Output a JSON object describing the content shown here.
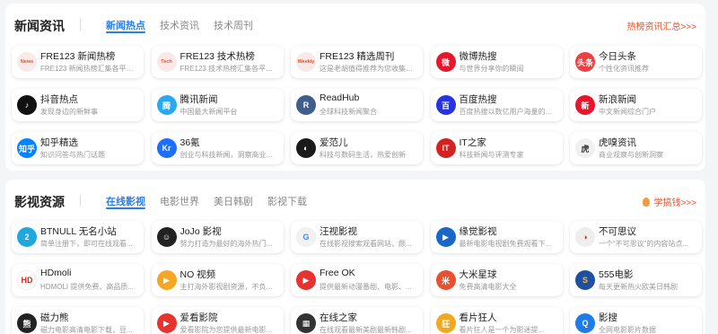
{
  "news": {
    "title": "新闻资讯",
    "tabs": [
      {
        "label": "新闻热点",
        "active": true
      },
      {
        "label": "技术资讯",
        "active": false
      },
      {
        "label": "技术周刊",
        "active": false
      }
    ],
    "more_link": "热榜资讯汇总>>>",
    "cards": [
      {
        "name": "FRE123 新闻热榜",
        "desc": "FRE123 新闻热榜汇集各平台热点新闻",
        "icon": "news-icon",
        "icon_text": "News",
        "color": "#fde8e8",
        "text_color": "#e5532b"
      },
      {
        "name": "FRE123 技术热榜",
        "desc": "FRE123 技术热榜汇集各平台技术文章",
        "icon": "tech-icon",
        "icon_text": "Tech",
        "color": "#fde8e8",
        "text_color": "#e5532b"
      },
      {
        "name": "FRE123 精选周刊",
        "desc": "这是老胡值得推荐为您收集的信息",
        "icon": "weekly-icon",
        "icon_text": "Weekly",
        "color": "#fde8e8",
        "text_color": "#e5532b"
      },
      {
        "name": "微博热搜",
        "desc": "与世界分享你的瞬间",
        "icon": "weibo-icon",
        "icon_text": "微",
        "color": "#e6162d",
        "text_color": "#ffffff"
      },
      {
        "name": "今日头条",
        "desc": "个性化资讯推荐",
        "icon": "toutiao-icon",
        "icon_text": "头条",
        "color": "#ed4040",
        "text_color": "#ffffff"
      },
      {
        "name": "抖音热点",
        "desc": "发现身边的新鲜事",
        "icon": "douyin-icon",
        "icon_text": "♪",
        "color": "#111111",
        "text_color": "#ffffff"
      },
      {
        "name": "腾讯新闻",
        "desc": "中国最大新闻平台",
        "icon": "tencent-news-icon",
        "icon_text": "腾",
        "color": "#2aa8f2",
        "text_color": "#ffffff"
      },
      {
        "name": "ReadHub",
        "desc": "全球科技新闻聚合",
        "icon": "readhub-icon",
        "icon_text": "R",
        "color": "#3f5e8c",
        "text_color": "#ffffff"
      },
      {
        "name": "百度热搜",
        "desc": "百度热搜以数亿用户海量的真实数据...",
        "icon": "baidu-icon",
        "icon_text": "百",
        "color": "#2932e1",
        "text_color": "#ffffff"
      },
      {
        "name": "新浪新闻",
        "desc": "中文新闻综合门户",
        "icon": "sina-icon",
        "icon_text": "新",
        "color": "#e6162d",
        "text_color": "#ffffff"
      },
      {
        "name": "知乎精选",
        "desc": "知识问答与热门话题",
        "icon": "zhihu-icon",
        "icon_text": "知乎",
        "color": "#0084ff",
        "text_color": "#ffffff"
      },
      {
        "name": "36氪",
        "desc": "创业与科技新闻，洞察商业...",
        "icon": "36kr-icon",
        "icon_text": "Kr",
        "color": "#1e6fff",
        "text_color": "#ffffff"
      },
      {
        "name": "爱范儿",
        "desc": "科技与数码生活，热爱创新",
        "icon": "ifanr-icon",
        "icon_text": "◐",
        "color": "#1a1a1a",
        "text_color": "#ffffff"
      },
      {
        "name": "IT之家",
        "desc": "科技新闻与评测专家",
        "icon": "ithome-icon",
        "icon_text": "IT",
        "color": "#d22222",
        "text_color": "#ffffff"
      },
      {
        "name": "虎嗅资讯",
        "desc": "商业观察与创新洞察",
        "icon": "huxiu-icon",
        "icon_text": "虎",
        "color": "#f0f0f0",
        "text_color": "#333333"
      }
    ]
  },
  "video": {
    "title": "影视资源",
    "tabs": [
      {
        "label": "在线影视",
        "active": true
      },
      {
        "label": "电影世界",
        "active": false
      },
      {
        "label": "美日韩剧",
        "active": false
      },
      {
        "label": "影视下载",
        "active": false
      }
    ],
    "more_link": "学搞钱>>>",
    "cards": [
      {
        "name": "BTNULL 无名小站",
        "desc": "简单注册下，即可在线观看...",
        "icon": "btnull-icon",
        "icon_text": "2",
        "color": "#1fa7e0",
        "text_color": "#ffffff"
      },
      {
        "name": "JoJo 影视",
        "desc": "努力打造为最好的海外热门...",
        "icon": "jojo-icon",
        "icon_text": "☺",
        "color": "#222222",
        "text_color": "#ffffff"
      },
      {
        "name": "汪视影视",
        "desc": "在线影视搜索观看网站，颜...",
        "icon": "wangshi-icon",
        "icon_text": "G",
        "color": "#f2f2f2",
        "text_color": "#4285f4"
      },
      {
        "name": "缘觉影视",
        "desc": "最新电影电视剧免费观看下...",
        "icon": "yuanjue-icon",
        "icon_text": "▶",
        "color": "#1a66c9",
        "text_color": "#ffffff"
      },
      {
        "name": "不可思议",
        "desc": "一个“不可思议”的内容站点...",
        "icon": "bukesiyi-icon",
        "icon_text": "◑",
        "color": "#eeeeee",
        "text_color": "#c0392b"
      },
      {
        "name": "HDmoli",
        "desc": "HDMOLI 提供免费、高品质...",
        "icon": "hdmoli-icon",
        "icon_text": "HD",
        "color": "#ffffff",
        "text_color": "#d7261f"
      },
      {
        "name": "NO 视频",
        "desc": "主打海外影视剧资源，不负...",
        "icon": "novideo-icon",
        "icon_text": "▶",
        "color": "#f5a623",
        "text_color": "#ffffff"
      },
      {
        "name": "Free OK",
        "desc": "提供最新动漫番剧、电影、...",
        "icon": "freeok-icon",
        "icon_text": "▶",
        "color": "#e8322f",
        "text_color": "#ffffff"
      },
      {
        "name": "大米星球",
        "desc": "免费高清电影大全",
        "icon": "dami-icon",
        "icon_text": "米",
        "color": "#e8502f",
        "text_color": "#ffffff"
      },
      {
        "name": "555电影",
        "desc": "每天更新热火欧美日韩剧",
        "icon": "555-icon",
        "icon_text": "S",
        "color": "#1f4fa3",
        "text_color": "#f5c518"
      },
      {
        "name": "磁力熊",
        "desc": "磁力电影高清电影下载，豆...",
        "icon": "cilixiong-icon",
        "icon_text": "熊",
        "color": "#222222",
        "text_color": "#ffffff"
      },
      {
        "name": "爱看影院",
        "desc": "爱看影院为您提供最新电影...",
        "icon": "aikan-icon",
        "icon_text": "▶",
        "color": "#e8322f",
        "text_color": "#ffffff"
      },
      {
        "name": "在线之家",
        "desc": "在线观看最新美剧最新韩剧...",
        "icon": "zxzj-icon",
        "icon_text": "▦",
        "color": "#333333",
        "text_color": "#ffffff"
      },
      {
        "name": "看片狂人",
        "desc": "看片狂人是一个为影迷提...",
        "icon": "kpkuang-icon",
        "icon_text": "狂",
        "color": "#f0a81f",
        "text_color": "#ffffff"
      },
      {
        "name": "影搜",
        "desc": "全网电影影片数据",
        "icon": "yingsou-icon",
        "icon_text": "Q",
        "color": "#1e7ce8",
        "text_color": "#ffffff"
      }
    ]
  }
}
